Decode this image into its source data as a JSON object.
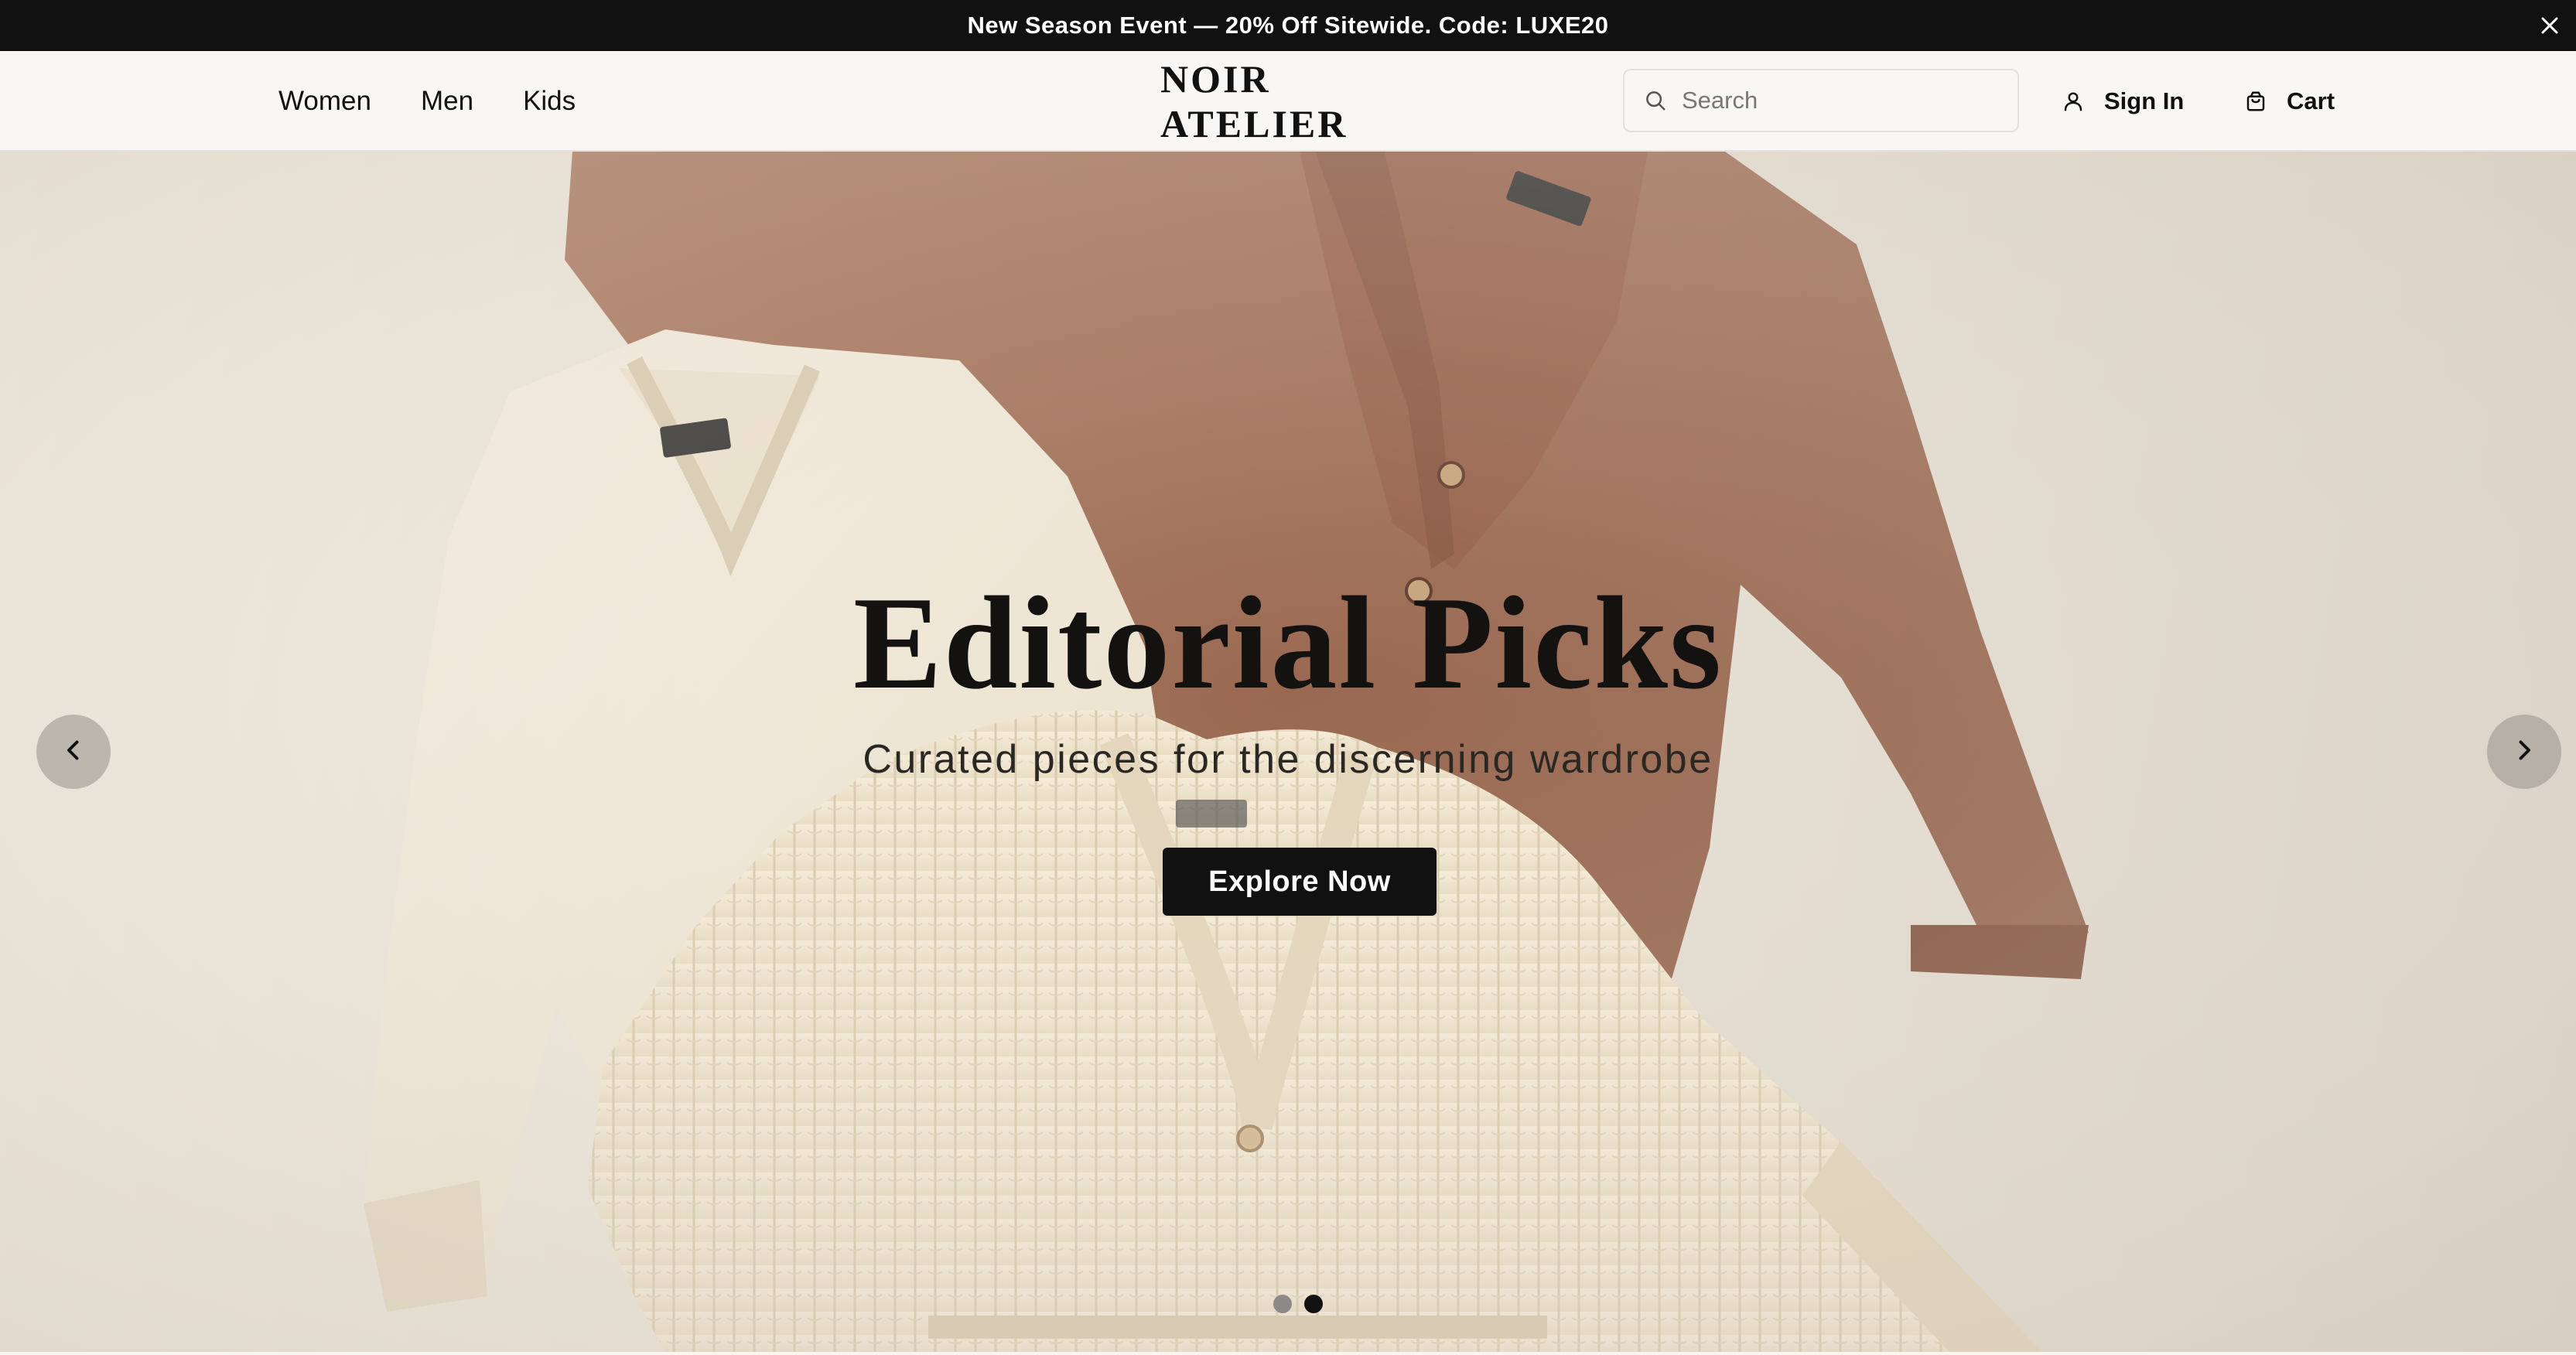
{
  "announcement": {
    "text": "New Season Event — 20% Off Sitewide. Code: LUXE20",
    "close_icon": "close-icon"
  },
  "header": {
    "nav": [
      {
        "label": "Women"
      },
      {
        "label": "Men"
      },
      {
        "label": "Kids"
      }
    ],
    "brand": "NOIR ATELIER",
    "search": {
      "placeholder": "Search",
      "value": "",
      "icon": "search-icon"
    },
    "account": {
      "label": "Sign In",
      "icon": "user-icon"
    },
    "cart": {
      "label": "Cart",
      "icon": "bag-icon"
    }
  },
  "hero": {
    "title": "Editorial Picks",
    "subtitle": "Curated pieces for the discerning wardrobe",
    "cta_label": "Explore Now",
    "prev_icon": "chevron-left-icon",
    "next_icon": "chevron-right-icon",
    "slide_count": 2,
    "active_slide": 2,
    "colors": {
      "background": "#e9e2d6",
      "cream_knit": "#f1e9d8",
      "brown_cardigan": "#9c6a52",
      "cta": "#111111"
    }
  }
}
